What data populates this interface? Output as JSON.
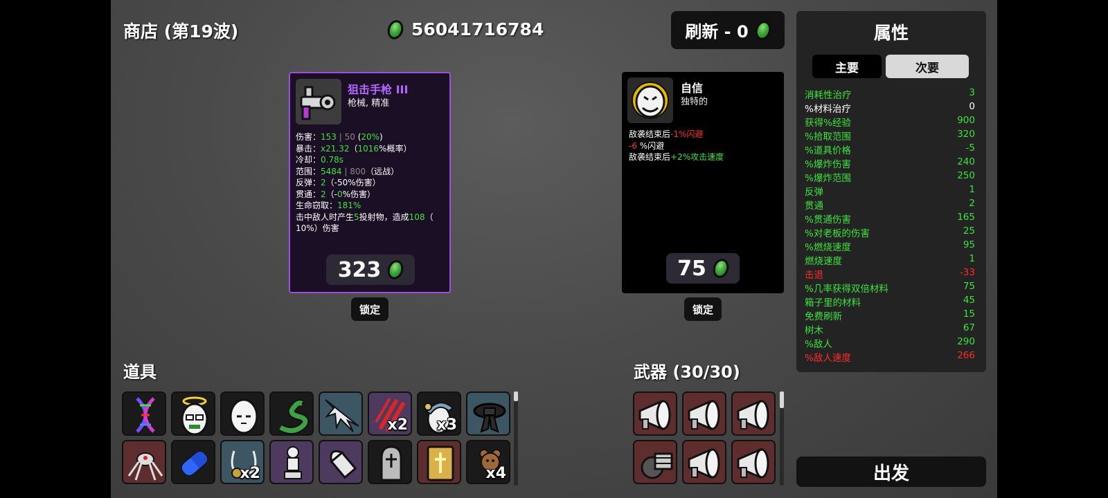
{
  "header": {
    "shop_title": "商店 (第19波)",
    "currency_amount": "56041716784",
    "refresh_label": "刷新 - 0"
  },
  "weapon_card": {
    "name": "狙击手枪 III",
    "tags": "枪械, 精准",
    "lines": [
      [
        [
          "w",
          "伤害："
        ],
        [
          "g",
          "153"
        ],
        [
          "gr",
          " | 50"
        ],
        [
          "w",
          " ("
        ],
        [
          "g",
          "20%"
        ],
        [
          "w",
          ")"
        ]
      ],
      [
        [
          "w",
          "暴击："
        ],
        [
          "g",
          "x21.32"
        ],
        [
          "w",
          "（"
        ],
        [
          "g",
          "1016"
        ],
        [
          "w",
          "%概率）"
        ]
      ],
      [
        [
          "w",
          "冷却："
        ],
        [
          "g",
          "0.78s"
        ]
      ],
      [
        [
          "w",
          "范围："
        ],
        [
          "g",
          "5484"
        ],
        [
          "gr",
          " | 800"
        ],
        [
          "w",
          "（远战）"
        ]
      ],
      [
        [
          "w",
          "反弹："
        ],
        [
          "g",
          "2"
        ],
        [
          "w",
          "（-50%伤害）"
        ]
      ],
      [
        [
          "w",
          "贯通："
        ],
        [
          "g",
          "2"
        ],
        [
          "w",
          "（-"
        ],
        [
          "g",
          "0"
        ],
        [
          "w",
          "%伤害）"
        ]
      ],
      [
        [
          "w",
          "生命窃取："
        ],
        [
          "g",
          "181%"
        ]
      ],
      [
        [
          "w",
          "击中敌人时产生"
        ],
        [
          "g",
          "5"
        ],
        [
          "w",
          "投射物，造成"
        ],
        [
          "g",
          "108"
        ],
        [
          "w",
          "（"
        ]
      ],
      [
        [
          "w",
          "10%"
        ],
        [
          "w",
          "）伤害"
        ]
      ]
    ],
    "price": "323",
    "lock_label": "锁定"
  },
  "item_card": {
    "name": "自信",
    "tags": "独特的",
    "lines": [
      [
        [
          "w",
          "敌袭结束后"
        ],
        [
          "r",
          "-1%闪避"
        ]
      ],
      [
        [
          "r",
          "-6"
        ],
        [
          "w",
          " %闪避"
        ]
      ],
      [
        [
          "w",
          "敌袭结束后"
        ],
        [
          "g",
          "+2%攻击速度"
        ]
      ]
    ],
    "price": "75",
    "lock_label": "锁定"
  },
  "items_section": {
    "title": "道具",
    "slots": [
      {
        "icon": "dna-icon",
        "bg": "black",
        "count": ""
      },
      {
        "icon": "angel-egg-icon",
        "bg": "black",
        "count": ""
      },
      {
        "icon": "egg-icon",
        "bg": "black",
        "count": ""
      },
      {
        "icon": "snake-icon",
        "bg": "black",
        "count": ""
      },
      {
        "icon": "feather-spike-icon",
        "bg": "blue",
        "count": ""
      },
      {
        "icon": "scratch-icon",
        "bg": "purple",
        "count": "x2"
      },
      {
        "icon": "helmet-egg-icon",
        "bg": "black",
        "count": "x3"
      },
      {
        "icon": "black-belt-icon",
        "bg": "blue",
        "count": ""
      },
      {
        "icon": "spider-robot-icon",
        "bg": "red",
        "count": ""
      },
      {
        "icon": "pill-icon",
        "bg": "black",
        "count": ""
      },
      {
        "icon": "necklace-icon",
        "bg": "blue",
        "count": "x2"
      },
      {
        "icon": "statue-icon",
        "bg": "purple",
        "count": ""
      },
      {
        "icon": "bullet-icon",
        "bg": "purple",
        "count": ""
      },
      {
        "icon": "tombstone-icon",
        "bg": "black",
        "count": ""
      },
      {
        "icon": "holy-book-icon",
        "bg": "red",
        "count": ""
      },
      {
        "icon": "teddy-bear-icon",
        "bg": "black",
        "count": "x4"
      }
    ]
  },
  "weapons_section": {
    "title": "武器 (30/30)",
    "slots": [
      {
        "icon": "megaphone-icon",
        "bg": "red"
      },
      {
        "icon": "megaphone-icon",
        "bg": "red"
      },
      {
        "icon": "megaphone-icon",
        "bg": "red"
      },
      {
        "icon": "minigun-icon",
        "bg": "red"
      },
      {
        "icon": "megaphone-icon",
        "bg": "red"
      },
      {
        "icon": "megaphone-icon",
        "bg": "red"
      }
    ]
  },
  "attributes": {
    "title": "属性",
    "tab_primary": "主要",
    "tab_secondary": "次要",
    "rows": [
      {
        "label": "消耗性治疗",
        "value": "3",
        "color": "green"
      },
      {
        "label": "%材料治疗",
        "value": "0",
        "color": "white"
      },
      {
        "label": "获得%经验",
        "value": "900",
        "color": "green"
      },
      {
        "label": "%拾取范围",
        "value": "320",
        "color": "green"
      },
      {
        "label": "%道具价格",
        "value": "-5",
        "color": "green"
      },
      {
        "label": "%爆炸伤害",
        "value": "240",
        "color": "green"
      },
      {
        "label": "%爆炸范围",
        "value": "250",
        "color": "green"
      },
      {
        "label": "反弹",
        "value": "1",
        "color": "green"
      },
      {
        "label": "贯通",
        "value": "2",
        "color": "green"
      },
      {
        "label": "%贯通伤害",
        "value": "165",
        "color": "green"
      },
      {
        "label": "%对老板的伤害",
        "value": "25",
        "color": "green"
      },
      {
        "label": "%燃烧速度",
        "value": "95",
        "color": "green"
      },
      {
        "label": "燃烧速度",
        "value": "1",
        "color": "green"
      },
      {
        "label": "击退",
        "value": "-33",
        "color": "red"
      },
      {
        "label": "%几率获得双倍材料",
        "value": "75",
        "color": "green"
      },
      {
        "label": "箱子里的材料",
        "value": "45",
        "color": "green"
      },
      {
        "label": "免费刷新",
        "value": "15",
        "color": "green"
      },
      {
        "label": "树木",
        "value": "67",
        "color": "green"
      },
      {
        "label": "%敌人",
        "value": "290",
        "color": "green"
      },
      {
        "label": "%敌人速度",
        "value": "266",
        "color": "red"
      }
    ]
  },
  "go_label": "出发",
  "colors": {
    "green": "#3ee33e",
    "red": "#ff2a2a",
    "white": "#ffffff",
    "gold_frame": "#8a44d0"
  }
}
